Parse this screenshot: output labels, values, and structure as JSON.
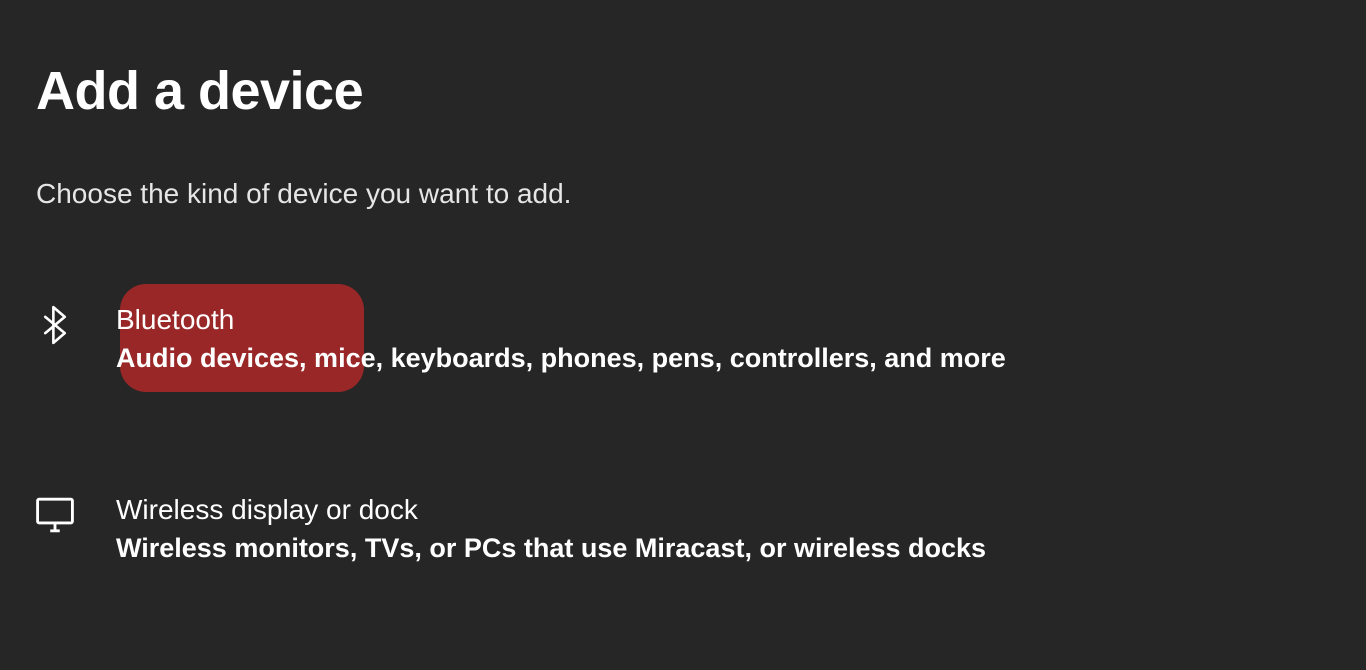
{
  "dialog": {
    "title": "Add a device",
    "subtitle": "Choose the kind of device you want to add."
  },
  "options": {
    "bluetooth": {
      "title": "Bluetooth",
      "description": "Audio devices, mice, keyboards, phones, pens, controllers, and more"
    },
    "wireless_display": {
      "title": "Wireless display or dock",
      "description": "Wireless monitors, TVs, or PCs that use Miracast, or wireless docks"
    }
  }
}
